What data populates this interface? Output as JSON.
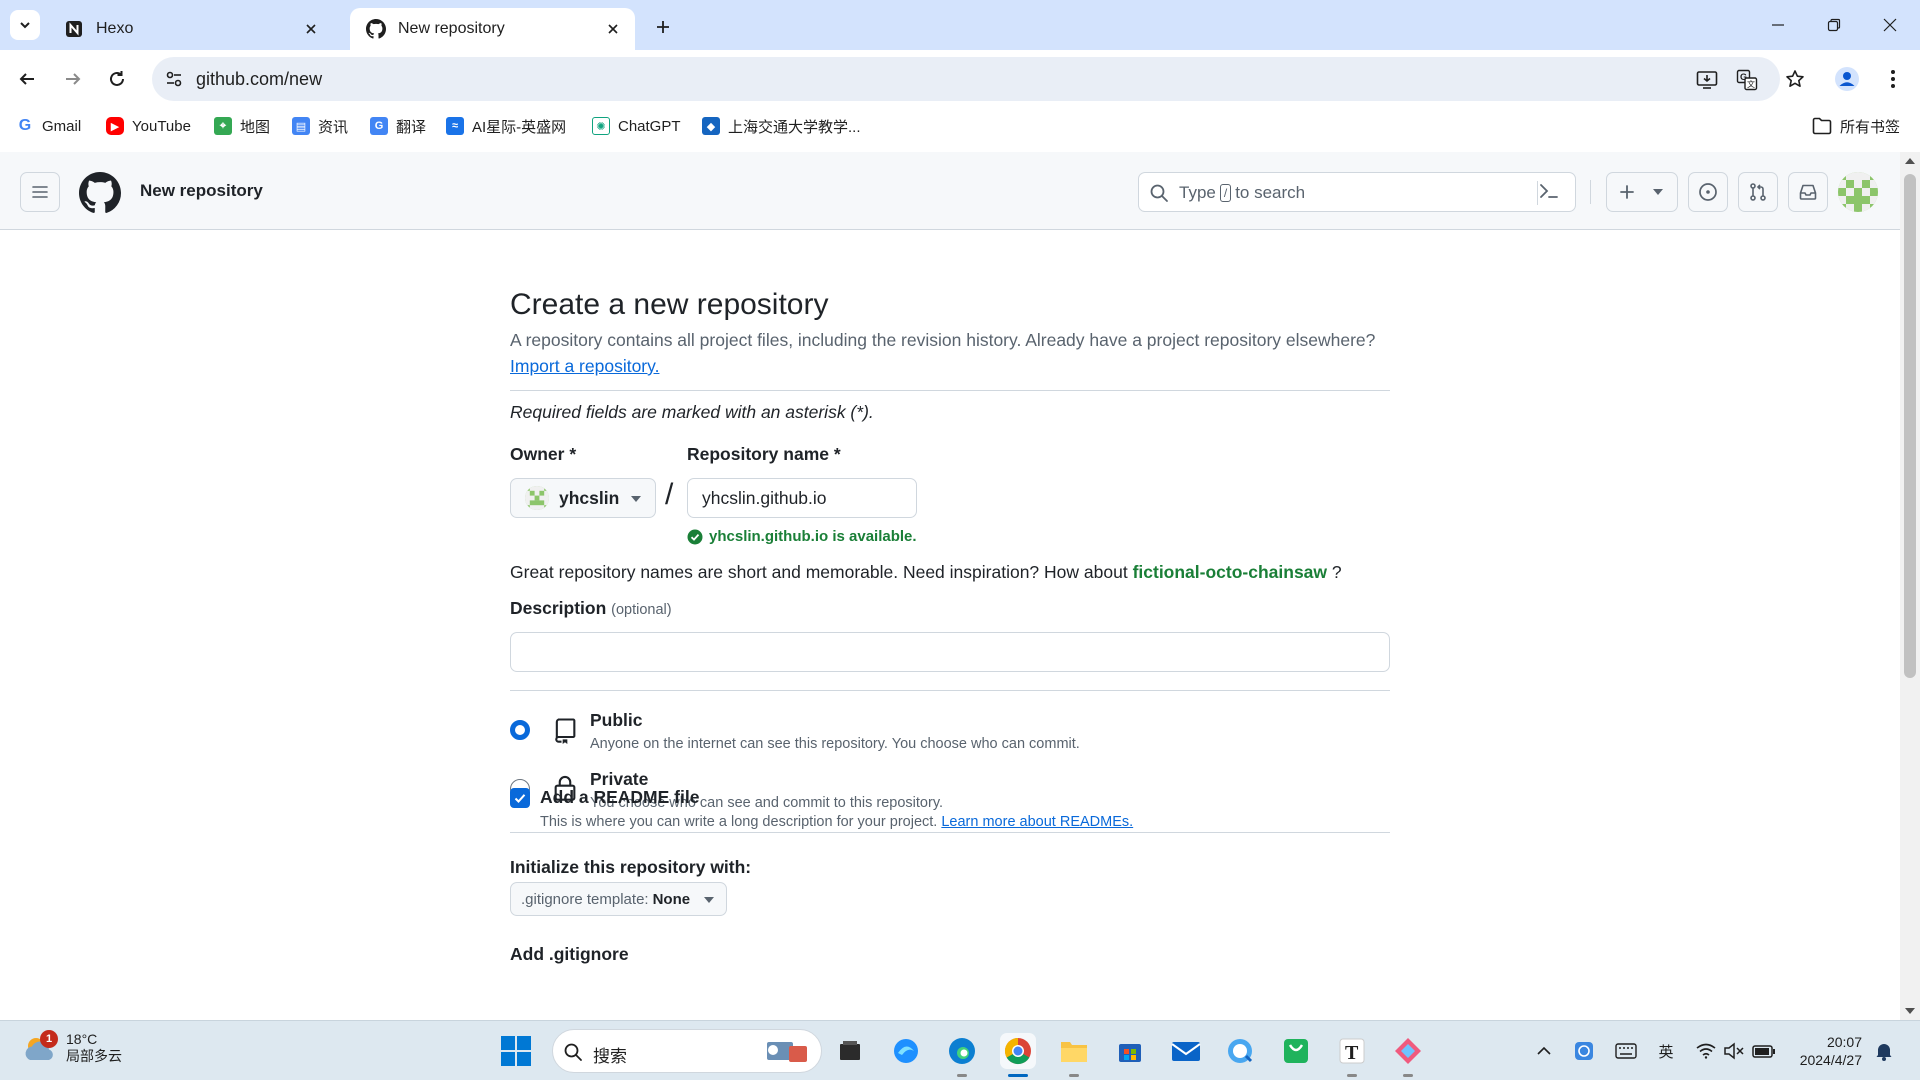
{
  "browser": {
    "tabs": [
      {
        "title": "Hexo",
        "active": false
      },
      {
        "title": "New repository",
        "active": true
      }
    ],
    "url": "github.com/new",
    "bookmarks": [
      "Gmail",
      "YouTube",
      "地图",
      "资讯",
      "翻译",
      "AI星际-英盛网",
      "ChatGPT",
      "上海交通大学教学..."
    ],
    "all_bookmarks": "所有书签"
  },
  "header": {
    "context": "New repository",
    "search_placeholder_pre": "Type",
    "search_key": "/",
    "search_placeholder_post": "to search"
  },
  "form": {
    "title": "Create a new repository",
    "subtitle": "A repository contains all project files, including the revision history. Already have a project repository elsewhere?",
    "import_link": "Import a repository.",
    "required_note": "Required fields are marked with an asterisk (*).",
    "owner_label": "Owner *",
    "owner_value": "yhcslin",
    "repo_label": "Repository name *",
    "repo_value": "yhcslin.github.io",
    "availability": "yhcslin.github.io is available.",
    "inspiration_text": "Great repository names are short and memorable. Need inspiration? How about",
    "inspiration_suggestion": "fictional-octo-chainsaw",
    "inspiration_end": "?",
    "description_label": "Description",
    "description_optional": "(optional)",
    "description_value": "",
    "visibility": [
      {
        "title": "Public",
        "desc": "Anyone on the internet can see this repository. You choose who can commit.",
        "selected": true
      },
      {
        "title": "Private",
        "desc": "You choose who can see and commit to this repository.",
        "selected": false
      }
    ],
    "init_label": "Initialize this repository with:",
    "readme_label": "Add a README file",
    "readme_desc": "This is where you can write a long description for your project.",
    "readme_link": "Learn more about READMEs.",
    "readme_checked": true,
    "gitignore_label": "Add .gitignore",
    "gitignore_btn_prefix": ".gitignore template:",
    "gitignore_btn_value": "None"
  },
  "taskbar": {
    "weather_temp": "18°C",
    "weather_desc": "局部多云",
    "weather_badge": "1",
    "search_placeholder": "搜索",
    "ime": "英",
    "time": "20:07",
    "date": "2024/4/27"
  },
  "colors": {
    "accent": "#0969da",
    "success": "#1a7f37",
    "chrome_tabstrip": "#d3e3fd"
  }
}
